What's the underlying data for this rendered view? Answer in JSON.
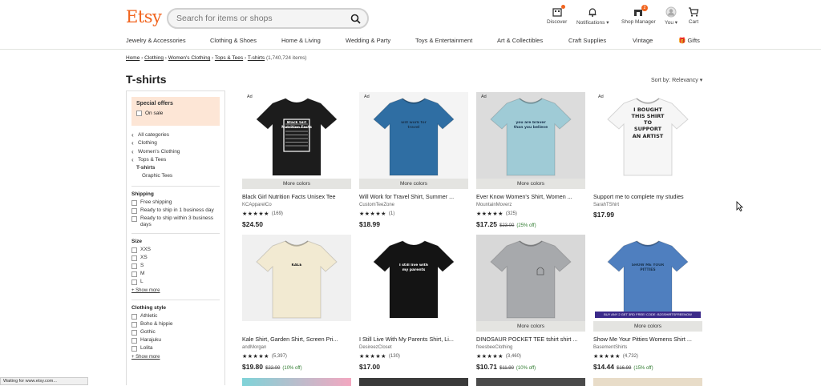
{
  "brand": {
    "logo": "Etsy",
    "accent": "#f1641e"
  },
  "search": {
    "placeholder": "Search for items or shops"
  },
  "header_icons": [
    {
      "label": "Discover",
      "icon": "discover-icon"
    },
    {
      "label": "Notifications",
      "icon": "bell-icon"
    },
    {
      "label": "Shop Manager",
      "icon": "shop-icon",
      "badge": "2"
    },
    {
      "label": "You",
      "icon": "avatar-icon"
    },
    {
      "label": "Cart",
      "icon": "cart-icon"
    }
  ],
  "categories": [
    "Jewelry & Accessories",
    "Clothing & Shoes",
    "Home & Living",
    "Wedding & Party",
    "Toys & Entertainment",
    "Art & Collectibles",
    "Craft Supplies",
    "Vintage",
    "Gifts"
  ],
  "breadcrumb": {
    "items": [
      "Home",
      "Clothing",
      "Women's Clothing",
      "Tops & Tees",
      "T-shirts"
    ],
    "count": "(1,740,724 items)"
  },
  "page_title": "T-shirts",
  "sort": "Sort by: Relevancy",
  "sidebar": {
    "special_title": "Special offers",
    "on_sale": "On sale",
    "nav": [
      "All categories",
      "Clothing",
      "Women's Clothing",
      "Tops & Tees",
      "T-shirts",
      "Graphic Tees"
    ],
    "shipping_title": "Shipping",
    "shipping": [
      "Free shipping",
      "Ready to ship in 1 business day",
      "Ready to ship within 3 business days"
    ],
    "size_title": "Size",
    "sizes": [
      "XXS",
      "XS",
      "S",
      "M",
      "L"
    ],
    "show_more": "+ Show more",
    "style_title": "Clothing style",
    "styles": [
      "Athletic",
      "Boho & hippie",
      "Gothic",
      "Harajuku",
      "Lolita"
    ],
    "show_more2": "+ Show more"
  },
  "more_colors": "More colors",
  "ad_label": "Ad",
  "products": [
    {
      "title": "Black Girl Nutrition Facts Unisex Tee",
      "shop": "KCApparelCo",
      "stars": "★★★★★",
      "reviews": "(169)",
      "price": "$24.50",
      "old": "",
      "off": "",
      "ad": true,
      "more": true,
      "shirt": "#1c1c1c",
      "bg": "#ffffff",
      "print": "Black Girl Nutrition Facts"
    },
    {
      "title": "Will Work for Travel Shirt, Summer ...",
      "shop": "CustomTeeZone",
      "stars": "★★★★★",
      "reviews": "(1)",
      "price": "$18.99",
      "old": "",
      "off": "",
      "ad": true,
      "more": true,
      "shirt": "#2f6ea3",
      "bg": "#f4f4f4",
      "print": "will work for travel"
    },
    {
      "title": "Ever Know Women's Shirt, Women ...",
      "shop": "MountainMoverz",
      "stars": "★★★★★",
      "reviews": "(325)",
      "price": "$17.25",
      "old": "$23.00",
      "off": "(25% off)",
      "ad": true,
      "more": true,
      "shirt": "#9fcbd6",
      "bg": "#dcdcdc",
      "print": "you are braver than you believe"
    },
    {
      "title": "Support me to complete my studies",
      "shop": "SarahTShirt",
      "stars": "",
      "reviews": "",
      "price": "$17.99",
      "old": "",
      "off": "",
      "ad": true,
      "more": false,
      "shirt": "#f6f6f6",
      "bg": "#ffffff",
      "print": "I BOUGHT THIS SHIRT TO SUPPORT AN ARTIST"
    },
    {
      "title": "Kale Shirt, Garden Shirt, Screen Pri...",
      "shop": "andMorgan",
      "stars": "★★★★★",
      "reviews": "(5,397)",
      "price": "$19.80",
      "old": "$22.00",
      "off": "(10% off)",
      "ad": false,
      "more": false,
      "shirt": "#f2ead2",
      "bg": "#f0f0f0",
      "print": "KALE"
    },
    {
      "title": "I Still Live With My Parents Shirt, Li...",
      "shop": "DesireezCloset",
      "stars": "★★★★★",
      "reviews": "(130)",
      "price": "$17.00",
      "old": "",
      "off": "",
      "ad": false,
      "more": false,
      "shirt": "#141414",
      "bg": "#ffffff",
      "print": "I still live with my parents"
    },
    {
      "title": "DINOSAUR POCKET TEE tshirt shirt ...",
      "shop": "freesbeeClothing",
      "stars": "★★★★★",
      "reviews": "(3,460)",
      "price": "$10.71",
      "old": "$11.90",
      "off": "(10% off)",
      "ad": false,
      "more": true,
      "shirt": "#a7a9ac",
      "bg": "#d8d8d8",
      "print": ""
    },
    {
      "title": "Show Me Your Pitties Womens Shirt ...",
      "shop": "BasementShirts",
      "stars": "★★★★★",
      "reviews": "(4,732)",
      "price": "$14.44",
      "old": "$16.99",
      "off": "(15% off)",
      "ad": false,
      "more": true,
      "shirt": "#4f7fbf",
      "bg": "#ffffff",
      "print": "SHOW ME YOUR PITTIES",
      "banner": "BUY ANY 2 GET 3RD FREE! CODE: B2GSHIRTSFREENOW"
    }
  ],
  "status": "Waiting for www.etsy.com..."
}
